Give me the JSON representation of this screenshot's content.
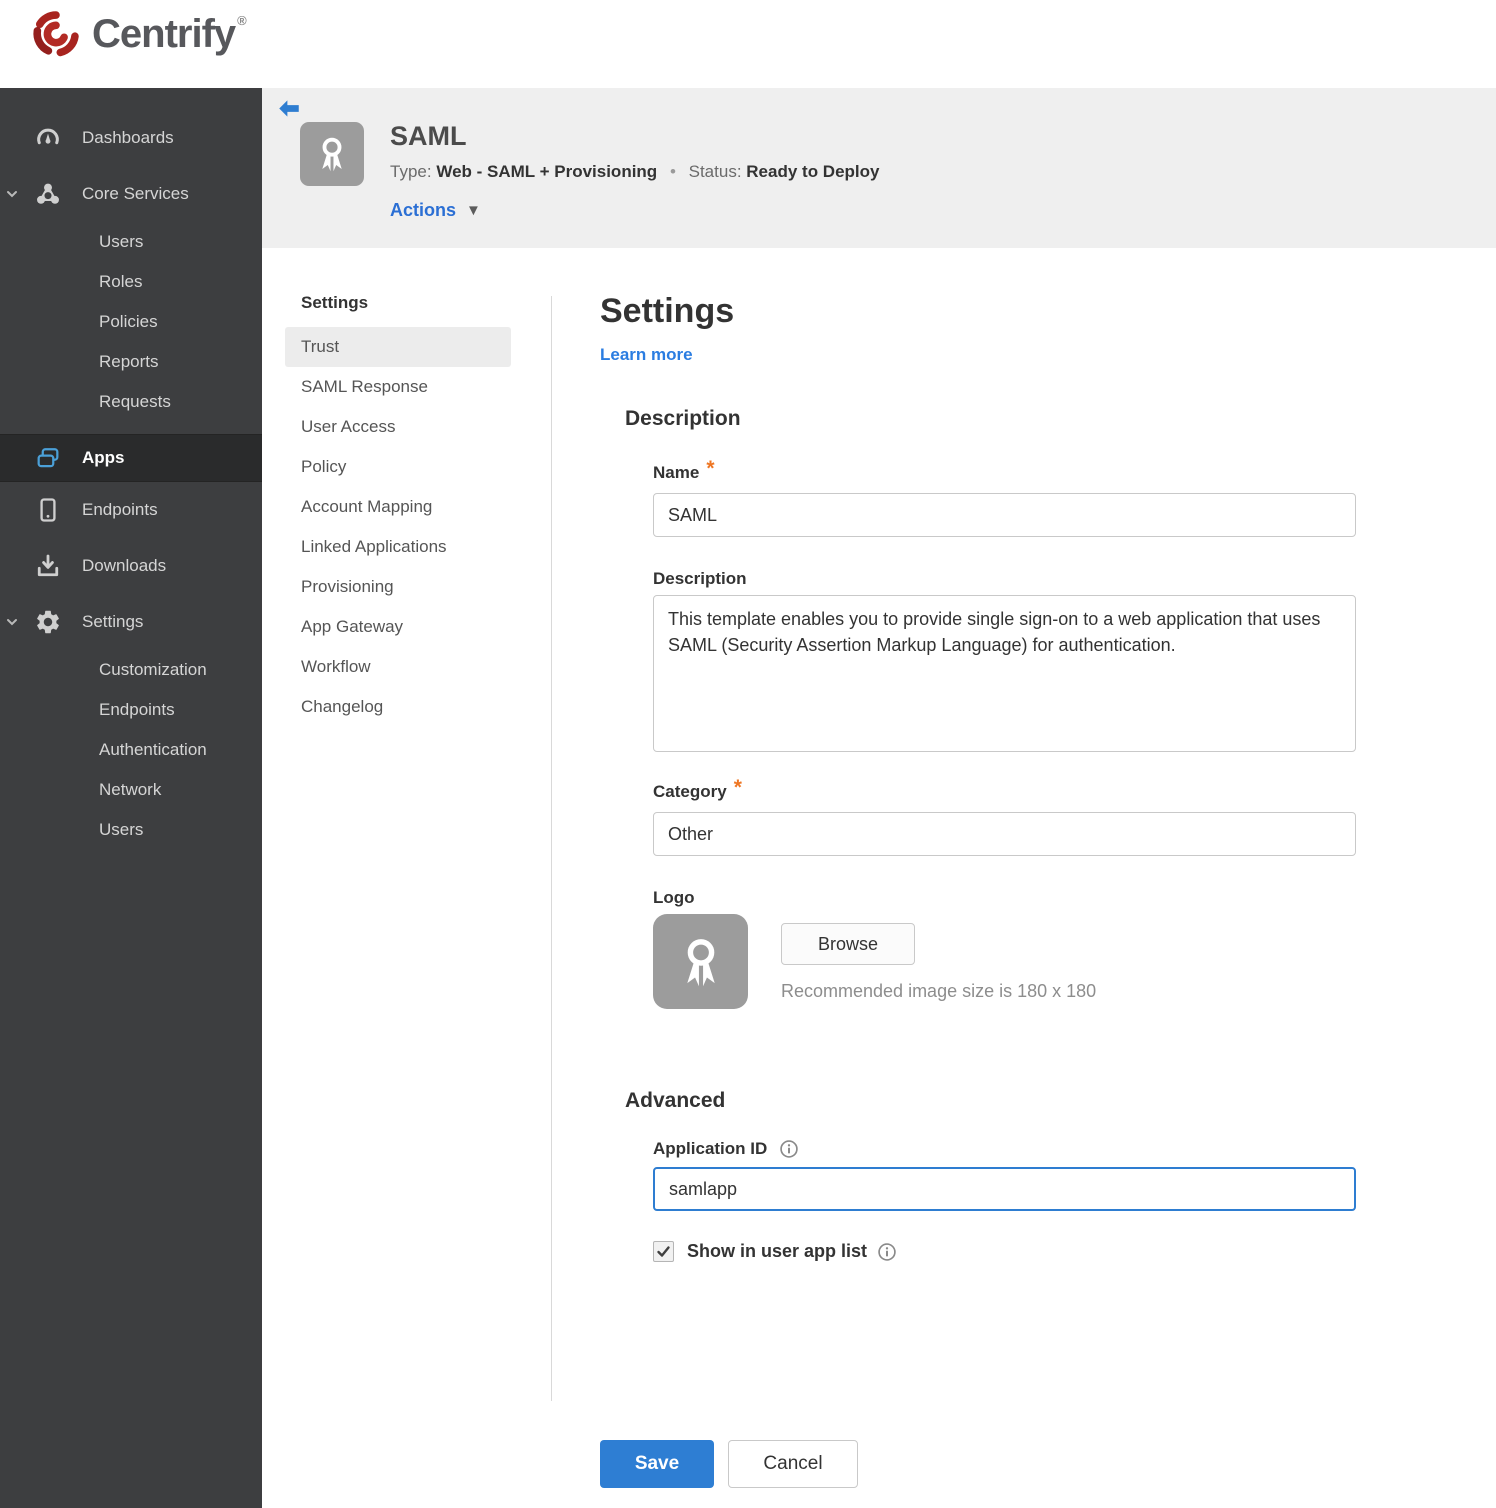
{
  "brand": {
    "name": "Centrify",
    "registered": "®"
  },
  "sidebar": {
    "items": [
      {
        "label": "Dashboards"
      },
      {
        "label": "Core Services"
      },
      {
        "label": "Users"
      },
      {
        "label": "Roles"
      },
      {
        "label": "Policies"
      },
      {
        "label": "Reports"
      },
      {
        "label": "Requests"
      },
      {
        "label": "Apps"
      },
      {
        "label": "Endpoints"
      },
      {
        "label": "Downloads"
      },
      {
        "label": "Settings"
      },
      {
        "label": "Customization"
      },
      {
        "label": "Endpoints"
      },
      {
        "label": "Authentication"
      },
      {
        "label": "Network"
      },
      {
        "label": "Users"
      }
    ],
    "selected": "Apps"
  },
  "header": {
    "title": "SAML",
    "type_label": "Type:",
    "type_value": "Web - SAML + Provisioning",
    "separator": "•",
    "status_label": "Status:",
    "status_value": "Ready to Deploy",
    "actions_label": "Actions",
    "caret": "▼"
  },
  "subnav": {
    "heading": "Settings",
    "items": [
      "Trust",
      "SAML Response",
      "User Access",
      "Policy",
      "Account Mapping",
      "Linked Applications",
      "Provisioning",
      "App Gateway",
      "Workflow",
      "Changelog"
    ],
    "active": "Trust"
  },
  "main": {
    "title": "Settings",
    "learn_more": "Learn more",
    "description_section": "Description",
    "required_marker": "*",
    "name_label": "Name",
    "name_value": "SAML",
    "description_label": "Description",
    "description_value": "This template enables you to provide single sign-on to a web application that uses SAML (Security Assertion Markup Language) for authentication.",
    "category_label": "Category",
    "category_value": "Other",
    "logo_label": "Logo",
    "browse_label": "Browse",
    "logo_hint": "Recommended image size is 180 x 180",
    "advanced_section": "Advanced",
    "app_id_label": "Application ID",
    "app_id_value": "samlapp",
    "show_in_app_list_label": "Show in user app list",
    "save_label": "Save",
    "cancel_label": "Cancel"
  },
  "colors": {
    "accent_blue": "#2e7dd1",
    "save_blue": "#2e7ed3",
    "status_red": "#a32222",
    "asterisk_orange": "#ee7623",
    "sidebar_bg": "#3d3e40",
    "sidebar_selected_bg": "#2a2b2c",
    "apps_icon_blue": "#4ba0d8",
    "header_bg": "#efefef",
    "logo_red": "#a8241f"
  }
}
